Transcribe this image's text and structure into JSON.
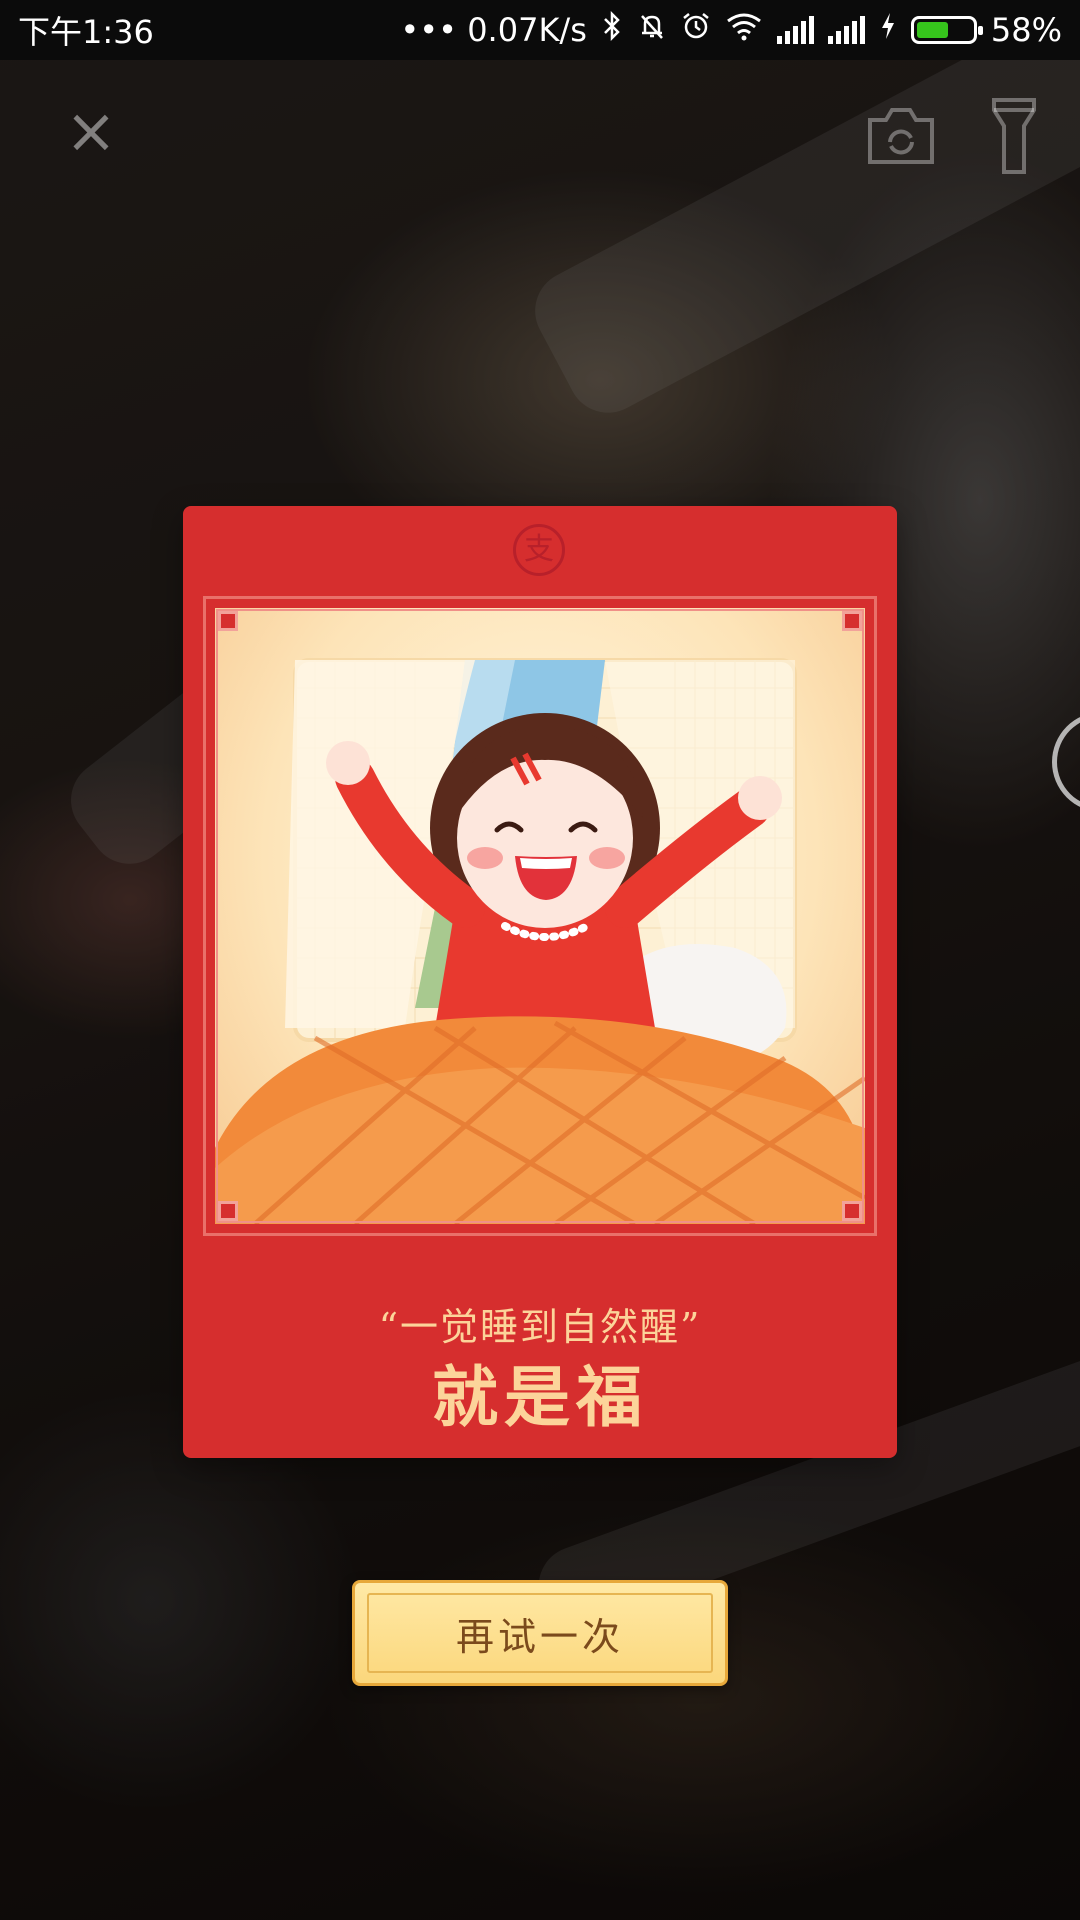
{
  "status_bar": {
    "time": "下午1:36",
    "network_speed": "••• 0.07K/s",
    "battery_percent": "58%",
    "battery_level": 0.58,
    "icons": [
      "bluetooth-icon",
      "mute-icon",
      "alarm-icon",
      "wifi-icon",
      "signal-icon",
      "signal-icon",
      "charging-icon",
      "battery-icon"
    ]
  },
  "scanner": {
    "close_icon": "close-icon",
    "camera_icon": "camera-switch-icon",
    "torch_icon": "flashlight-icon"
  },
  "card": {
    "seal_text": "支",
    "quote": "“一觉睡到自然醒”",
    "blessing": "就是福",
    "illustration": "girl-waking-up-illustration",
    "colors": {
      "card": "#d62e2e",
      "text": "#fcd49a"
    }
  },
  "retry_button": {
    "label": "再试一次",
    "colors": {
      "background": "#fbd77c",
      "text": "#7b4a1c"
    }
  }
}
